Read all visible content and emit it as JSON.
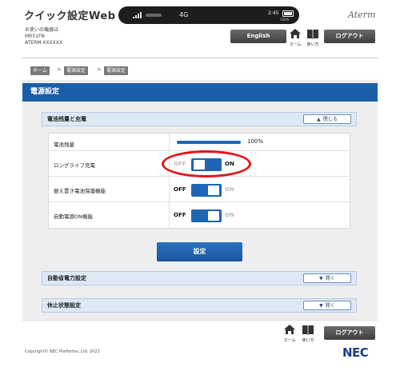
{
  "header": {
    "app_title": "クイック設定Web",
    "device_label": "お使いの機器は",
    "device_model": "MR51FN",
    "device_id": "ATERM-XXXXXX",
    "brand": "Aterm",
    "english_label": "English",
    "home_label": "ホーム",
    "help_label": "使い方",
    "logout_label": "ログアウト"
  },
  "status_bar": {
    "network_type": "4G",
    "clock": "2:45",
    "battery_pct": "100%"
  },
  "breadcrumb": [
    "ホーム",
    "電源設定",
    "電源設定"
  ],
  "page": {
    "title": "電源設定"
  },
  "battery_section": {
    "title": "電池残量と充電",
    "toggle_label": "閉じる",
    "rows": {
      "level_label": "電池残量",
      "level_value": "100%",
      "level_fraction": 1.0,
      "longlife_label": "ロングライフ充電",
      "protect_label": "据え置き電池保護機能",
      "autopower_label": "自動電源ON機能"
    },
    "switch_off": "OFF",
    "switch_on": "ON",
    "longlife_state": "ON",
    "protect_state": "OFF",
    "autopower_state": "OFF"
  },
  "set_button": "設定",
  "powersave_section": {
    "title": "自動省電力設定",
    "toggle_label": "開く"
  },
  "sleep_section": {
    "title": "休止状態設定",
    "toggle_label": "開く"
  },
  "footer": {
    "copyright": "Copyright© NEC Platforms, Ltd. 2022",
    "logo": "NEC"
  },
  "colors": {
    "accent_blue": "#1b5ea8",
    "switch_blue": "#1f65b5",
    "highlight_red": "#e0161b"
  }
}
